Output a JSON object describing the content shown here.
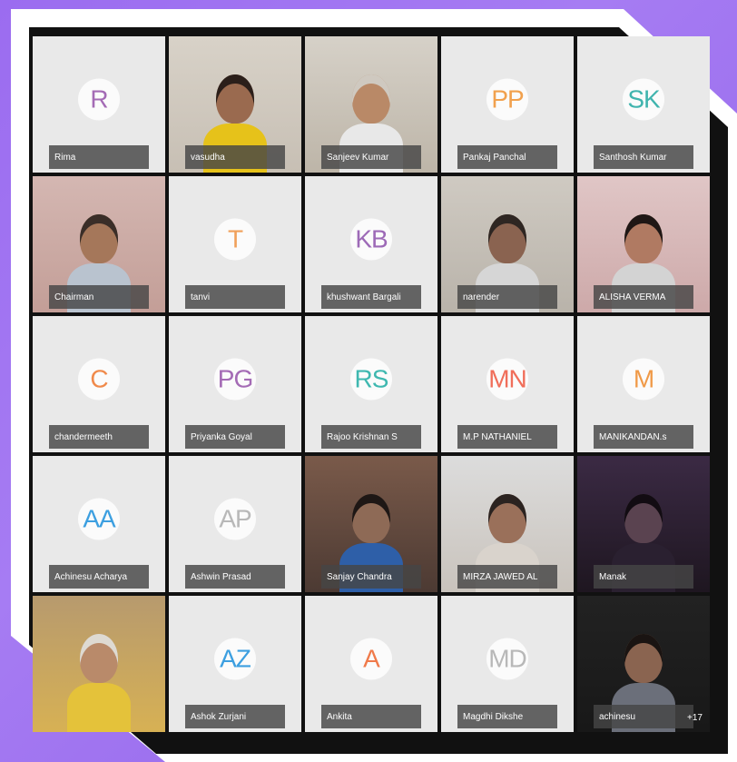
{
  "participants": [
    {
      "name": "Rima",
      "initials": "R",
      "color": "#a46bb5",
      "video": false
    },
    {
      "name": "vasudha",
      "initials": "",
      "color": "",
      "video": true,
      "scene": "woman"
    },
    {
      "name": "Sanjeev Kumar",
      "initials": "",
      "color": "",
      "video": true,
      "scene": "man-white"
    },
    {
      "name": "Pankaj Panchal",
      "initials": "PP",
      "color": "#f1a14e",
      "video": false
    },
    {
      "name": "Santhosh Kumar",
      "initials": "SK",
      "color": "#40b4ae",
      "video": false
    },
    {
      "name": "Chairman",
      "initials": "",
      "color": "",
      "video": true,
      "scene": "man-pink"
    },
    {
      "name": "tanvi",
      "initials": "T",
      "color": "#f0a05a",
      "video": false
    },
    {
      "name": "khushwant Bargali",
      "initials": "KB",
      "color": "#9d6ab7",
      "video": false
    },
    {
      "name": "narender",
      "initials": "",
      "color": "",
      "video": true,
      "scene": "man-grey"
    },
    {
      "name": "ALISHA VERMA",
      "initials": "",
      "color": "",
      "video": true,
      "scene": "woman-pink"
    },
    {
      "name": "chandermeeth",
      "initials": "C",
      "color": "#f08a4b",
      "video": false
    },
    {
      "name": "Priyanka Goyal",
      "initials": "PG",
      "color": "#a46bb5",
      "video": false
    },
    {
      "name": "Rajoo Krishnan S",
      "initials": "RS",
      "color": "#3fb8b0",
      "video": false
    },
    {
      "name": "M.P NATHANIEL",
      "initials": "MN",
      "color": "#f06e5a",
      "video": false
    },
    {
      "name": "MANIKANDAN.s",
      "initials": "M",
      "color": "#f09a48",
      "video": false
    },
    {
      "name": "Achinesu Acharya",
      "initials": "AA",
      "color": "#3c9fe0",
      "video": false
    },
    {
      "name": "Ashwin Prasad",
      "initials": "AP",
      "color": "#b8b8b8",
      "video": false
    },
    {
      "name": "Sanjay Chandra",
      "initials": "",
      "color": "",
      "video": true,
      "scene": "headset"
    },
    {
      "name": "MIRZA JAWED AL",
      "initials": "",
      "color": "",
      "video": true,
      "scene": "dim"
    },
    {
      "name": "Manak",
      "initials": "",
      "color": "",
      "video": true,
      "scene": "dark"
    },
    {
      "name": "",
      "initials": "",
      "color": "",
      "video": true,
      "scene": "elder"
    },
    {
      "name": "Ashok Zurjani",
      "initials": "AZ",
      "color": "#3c9fe0",
      "video": false
    },
    {
      "name": "Ankita",
      "initials": "A",
      "color": "#f07a4a",
      "video": false
    },
    {
      "name": "Magdhi Dikshe",
      "initials": "MD",
      "color": "#b8b8b8",
      "video": false
    },
    {
      "name": "achinesu",
      "initials": "",
      "color": "",
      "video": true,
      "scene": "corner",
      "extra": "+17"
    }
  ]
}
